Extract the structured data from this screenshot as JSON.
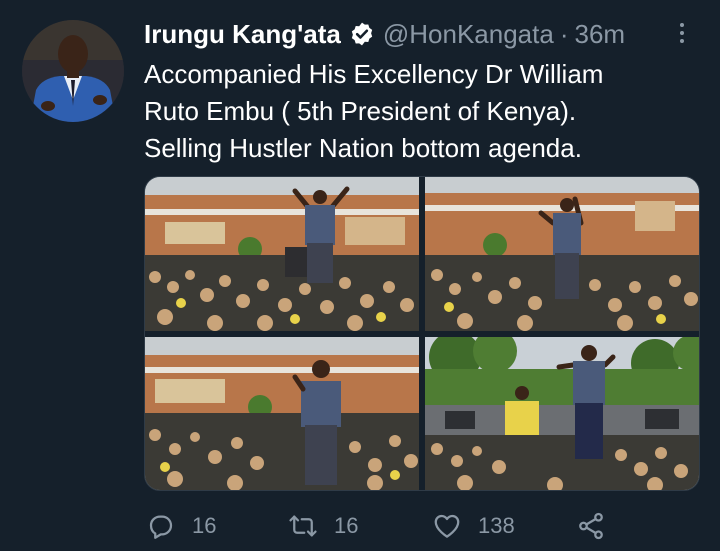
{
  "tweet": {
    "author_name": "Irungu Kang'ata",
    "handle": "@HonKangata",
    "separator": "·",
    "time": "36m",
    "text_lines": [
      "Accompanied His Excellency Dr William",
      "Ruto Embu ( 5th President of Kenya).",
      "Selling Hustler Nation bottom agenda."
    ]
  },
  "actions": {
    "reply_count": "16",
    "retweet_count": "16",
    "like_count": "138"
  },
  "icons": {
    "verified": "verified-badge-icon",
    "more": "more-options-icon",
    "reply": "reply-icon",
    "retweet": "retweet-icon",
    "like": "heart-icon",
    "share": "share-icon"
  },
  "colors": {
    "background": "#15202b",
    "text_primary": "#ffffff",
    "text_secondary": "#8b98a5"
  }
}
